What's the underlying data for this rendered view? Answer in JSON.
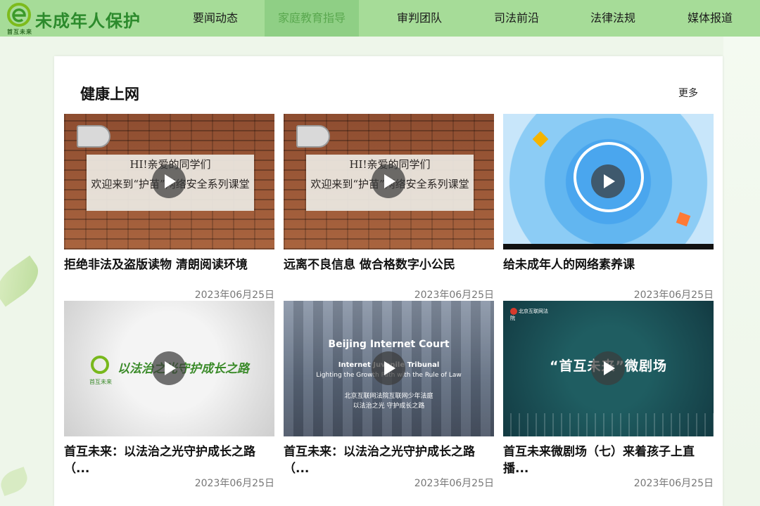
{
  "header": {
    "logo_text": "未成年人保护",
    "logo_sub": "首互未来",
    "nav": [
      "要闻动态",
      "家庭教育指导",
      "审判团队",
      "司法前沿",
      "法律法规",
      "媒体报道"
    ],
    "active_nav": "家庭教育指导"
  },
  "section": {
    "title": "健康上网",
    "more": "更多"
  },
  "cards": [
    {
      "title": "拒绝非法及盗版读物 清朗阅读环境",
      "date": "2023年06月25日",
      "thumb_text": [
        "HI!亲爱的同学们",
        "欢迎来到“护苗”网络安全系列课堂"
      ]
    },
    {
      "title": "远离不良信息 做合格数字小公民",
      "date": "2023年06月25日",
      "thumb_text": [
        "HI!亲爱的同学们",
        "欢迎来到“护苗”网络安全系列课堂"
      ]
    },
    {
      "title": "给未成年人的网络素养课",
      "date": "2023年06月25日"
    },
    {
      "title": "首互未来：以法治之光守护成长之路（...",
      "date": "2023年06月25日",
      "thumb_text": "以法治之光守护成长之路",
      "thumb_sub": "首互未来"
    },
    {
      "title": "首互未来：以法治之光守护成长之路（...",
      "date": "2023年06月25日",
      "thumb_text": [
        "Beijing Internet Court",
        "Internet Juvenile Tribunal",
        "Lighting the Growth Path with the Rule of Law",
        "北京互联网法院互联网少年法庭",
        "以法治之光 守护成长之路"
      ]
    },
    {
      "title": "首互未来微剧场（七）来着孩子上直播...",
      "date": "2023年06月25日",
      "thumb_text": "“首互未来”微剧场",
      "thumb_badge": "北京互联网法院"
    }
  ]
}
